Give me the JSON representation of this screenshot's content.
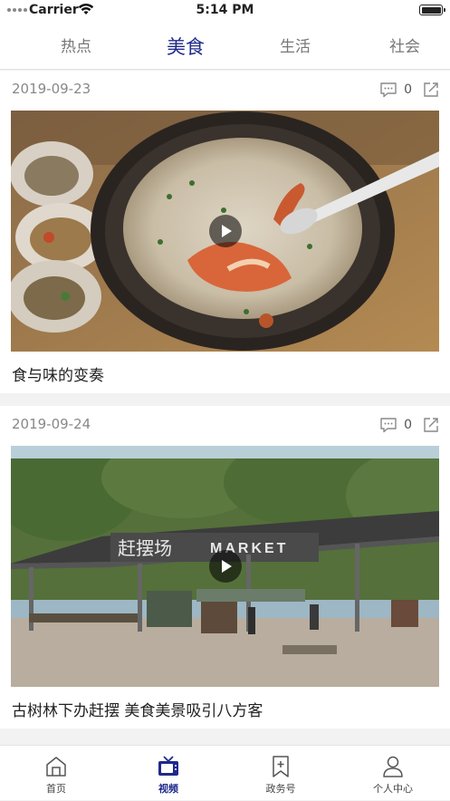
{
  "status_bar": {
    "carrier": "Carrier",
    "time": "5:14 PM"
  },
  "tabs": [
    {
      "label": "热点",
      "active": false
    },
    {
      "label": "美食",
      "active": true
    },
    {
      "label": "生活",
      "active": false
    },
    {
      "label": "社会",
      "active": false
    }
  ],
  "videos": [
    {
      "date": "2019-09-23",
      "comments": "0",
      "title": "食与味的变奏"
    },
    {
      "date": "2019-09-24",
      "comments": "0",
      "title": "古树林下办赶摆 美食美景吸引八方客"
    }
  ],
  "scene_text": {
    "market_sign_cn": "赶摆场",
    "market_sign_en": "MARKET"
  },
  "bottom_nav": [
    {
      "label": "首页",
      "icon": "home-icon",
      "active": false
    },
    {
      "label": "视频",
      "icon": "tv-icon",
      "active": true
    },
    {
      "label": "政务号",
      "icon": "bookmark-plus-icon",
      "active": false
    },
    {
      "label": "个人中心",
      "icon": "person-icon",
      "active": false
    }
  ],
  "colors": {
    "accent": "#1f2a8a",
    "inactive": "#777777",
    "divider": "#f2f2f2"
  }
}
